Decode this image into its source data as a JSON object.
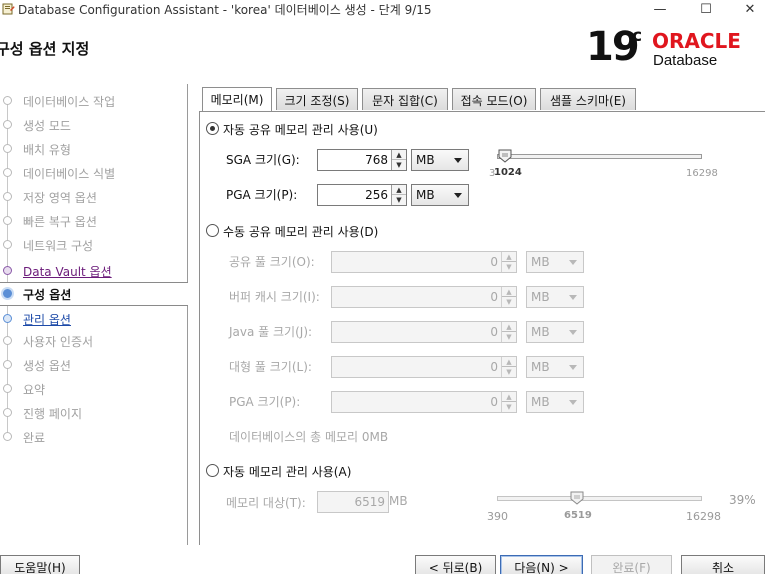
{
  "window": {
    "title": "Database Configuration Assistant - 'korea' 데이터베이스 생성 - 단계 9/15",
    "minimize_glyph": "—",
    "maximize_glyph": "☐",
    "close_glyph": "✕"
  },
  "header": {
    "page_title": "구성 옵션 지정",
    "logo": {
      "version": "19",
      "superscript": "c",
      "brand": "ORACLE",
      "product": "Database",
      "brand_color": "#e0161e"
    }
  },
  "sidebar": {
    "steps": [
      {
        "label": "데이터베이스 작업",
        "state": "done"
      },
      {
        "label": "생성 모드",
        "state": "done"
      },
      {
        "label": "배치 유형",
        "state": "done"
      },
      {
        "label": "데이터베이스 식별",
        "state": "done"
      },
      {
        "label": "저장 영역 옵션",
        "state": "done"
      },
      {
        "label": "빠른 복구 옵션",
        "state": "done"
      },
      {
        "label": "네트워크 구성",
        "state": "done"
      },
      {
        "label": "Data Vault 옵션",
        "state": "link"
      },
      {
        "label": "구성 옵션",
        "state": "current"
      },
      {
        "label": "관리 옵션",
        "state": "next"
      },
      {
        "label": "사용자 인증서",
        "state": "pending"
      },
      {
        "label": "생성 옵션",
        "state": "pending"
      },
      {
        "label": "요약",
        "state": "pending"
      },
      {
        "label": "진행 페이지",
        "state": "pending"
      },
      {
        "label": "완료",
        "state": "pending"
      }
    ]
  },
  "tabs": [
    {
      "label": "메모리(M)",
      "active": true
    },
    {
      "label": "크기 조정(S)",
      "active": false
    },
    {
      "label": "문자 집합(C)",
      "active": false
    },
    {
      "label": "접속 모드(O)",
      "active": false
    },
    {
      "label": "샘플 스키마(E)",
      "active": false
    }
  ],
  "memory": {
    "auto_shared": {
      "label": "자동 공유 메모리 관리 사용(U)",
      "selected": true,
      "sga_label": "SGA 크기(G):",
      "sga_value": "768",
      "sga_unit": "MB",
      "pga_label": "PGA 크기(P):",
      "pga_value": "256",
      "pga_unit": "MB",
      "slider_min": "1024",
      "slider_min_prefix": "3",
      "slider_max": "16298",
      "slider_fraction": 0.04
    },
    "manual_shared": {
      "label": "수동 공유 메모리 관리 사용(D)",
      "selected": false,
      "fields": [
        {
          "label": "공유 풀 크기(O):",
          "value": "0",
          "unit": "MB"
        },
        {
          "label": "버퍼 캐시 크기(I):",
          "value": "0",
          "unit": "MB"
        },
        {
          "label": "Java 풀 크기(J):",
          "value": "0",
          "unit": "MB"
        },
        {
          "label": "대형 풀 크기(L):",
          "value": "0",
          "unit": "MB"
        },
        {
          "label": "PGA 크기(P):",
          "value": "0",
          "unit": "MB"
        }
      ],
      "total_text": "데이터베이스의 총 메모리 0MB"
    },
    "auto_memory": {
      "label": "자동 메모리 관리 사용(A)",
      "selected": false,
      "target_label": "메모리 대상(T):",
      "target_value": "6519",
      "target_unit": "MB",
      "percent": "39%",
      "slider_min": "390",
      "slider_value": "6519",
      "slider_max": "16298",
      "slider_fraction": 0.39
    }
  },
  "buttons": {
    "help": "도움말(H)",
    "back": "< 뒤로(B)",
    "next": "다음(N) >",
    "finish": "완료(F)",
    "cancel": "취소"
  }
}
